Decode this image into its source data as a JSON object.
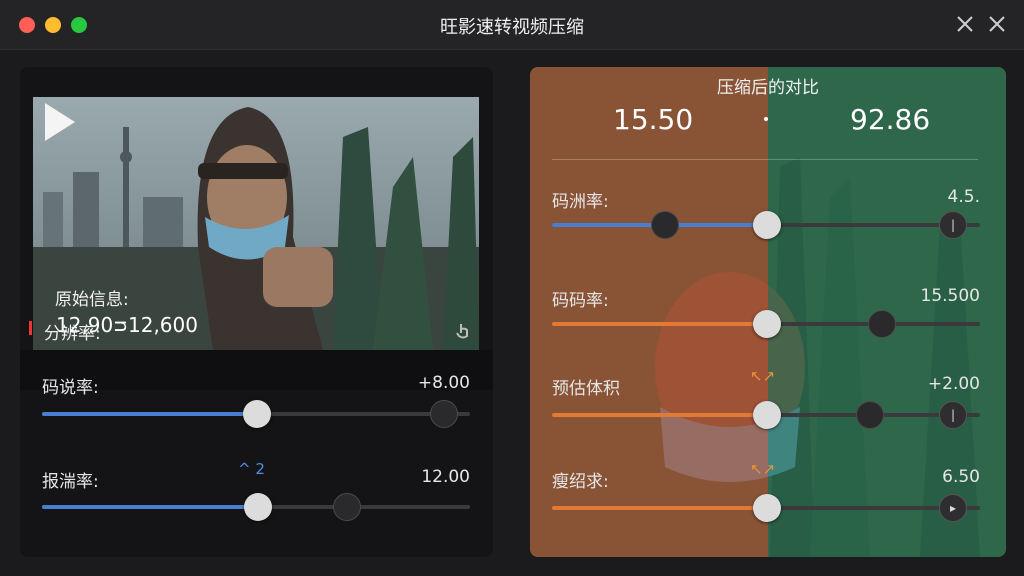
{
  "window": {
    "title": "旺影速转视频压缩",
    "controls": {
      "traffic": [
        "close",
        "minimize",
        "zoom"
      ],
      "right_icons": [
        "close-icon",
        "close-icon"
      ]
    }
  },
  "left_panel": {
    "video": {
      "play_icon": "play-icon"
    },
    "info_label": "原始信息:",
    "info_value": "12,90ᴝ12,600",
    "resolution_label": "分辨率:",
    "corner_icon": "tap-icon",
    "sliders": [
      {
        "label": "码说率:",
        "value": "+8.00",
        "level": 0.5,
        "color": "#4a7fd0"
      },
      {
        "label": "报湍率:",
        "value": "12.00",
        "level": 0.5,
        "color": "#4a7fd0",
        "hint": "^ 2"
      }
    ]
  },
  "right_panel": {
    "title": "压缩后的对比",
    "value_left": "15.50",
    "value_right": "92.86",
    "colors": {
      "left": "#c9532a",
      "right": "#2e7d58",
      "slider_blue": "#4a7fd0",
      "slider_orange": "#e07a35"
    },
    "sliders": [
      {
        "label": "码洲率:",
        "value": "4.5.",
        "level": 0.5,
        "color": "#4a7fd0"
      },
      {
        "label": "码码率:",
        "value": "15.500",
        "level": 0.5,
        "color": "#e07a35"
      },
      {
        "label": "预估体积",
        "value": "+2.00",
        "level": 0.5,
        "color": "#e07a35",
        "hint": "↖↗"
      },
      {
        "label": "瘦绍求:",
        "value": "6.50",
        "level": 0.5,
        "color": "#e07a35",
        "hint": "↖↗"
      }
    ]
  }
}
